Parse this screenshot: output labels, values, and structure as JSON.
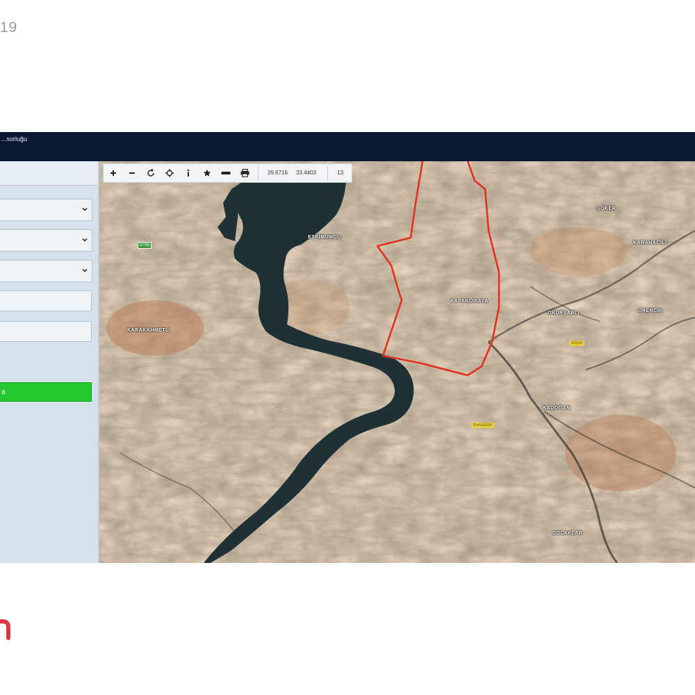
{
  "corner_text": "19",
  "app": {
    "title": "...sorluğu"
  },
  "sidebar": {
    "panel_title": "",
    "selects": [
      {
        "value": ""
      },
      {
        "value": ""
      },
      {
        "value": ""
      }
    ],
    "fields": [
      {
        "value": "",
        "placeholder": ""
      },
      {
        "value": "",
        "placeholder": ""
      }
    ],
    "submit_label": "a"
  },
  "toolbar": {
    "tools": [
      "zoom-in",
      "zoom-out",
      "refresh",
      "locate",
      "info",
      "favorite",
      "measure",
      "print"
    ],
    "coord_lat": "39.6716",
    "coord_lon": "33.4403",
    "zoom_level": "13"
  },
  "map": {
    "labels": [
      {
        "text": "ESKİMUMCU"
      },
      {
        "text": "KARAKAHMETLİ"
      },
      {
        "text": "GÖKER"
      },
      {
        "text": "KARAHACILI"
      },
      {
        "text": "KAPAKLIKAYA"
      },
      {
        "text": "OKURŞARLI"
      },
      {
        "text": "KADOĞAN"
      },
      {
        "text": "ÖRENCİK"
      },
      {
        "text": "ÇOLAKLAR"
      }
    ],
    "road_badge": "D765",
    "yellow_badges": [
      "Köprü",
      "Kuruüzüm"
    ]
  },
  "colors": {
    "topbar": "#0c1734",
    "sidebar": "#d7e1ec",
    "submit": "#25c92f",
    "boundary": "#e0321d",
    "water": "#1f3134"
  }
}
